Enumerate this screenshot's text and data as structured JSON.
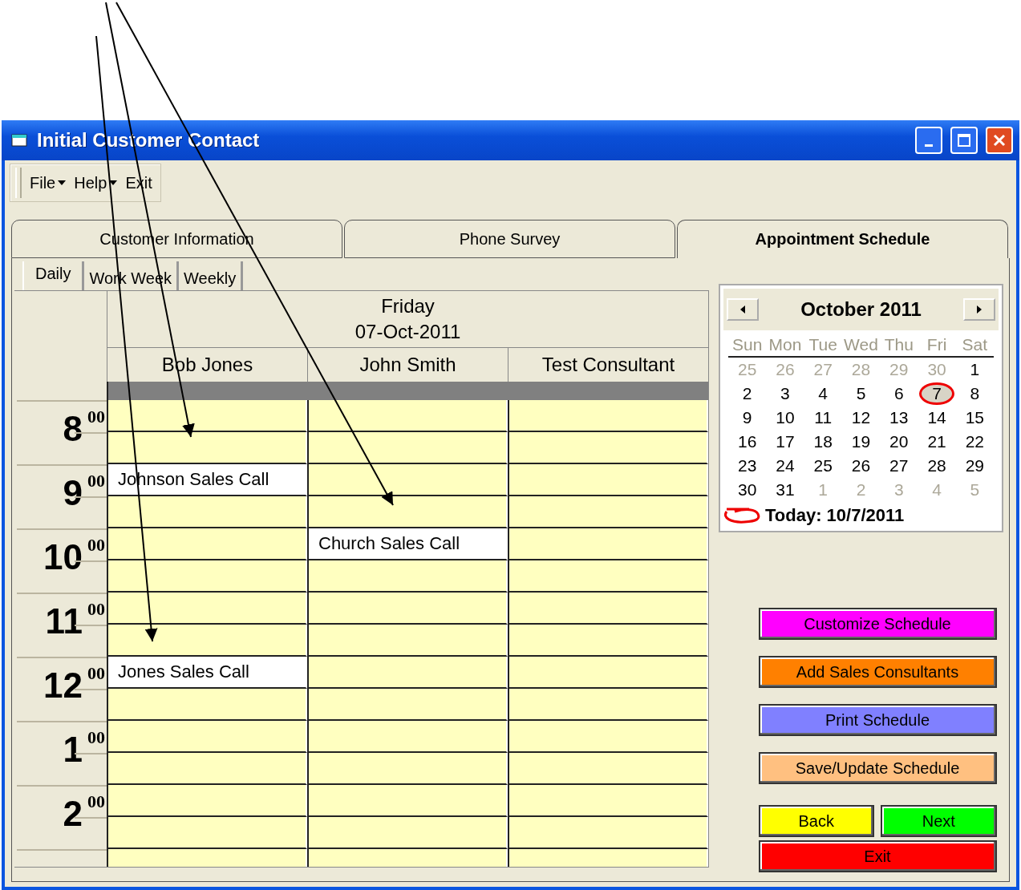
{
  "window": {
    "title": "Initial Customer Contact"
  },
  "menu": [
    {
      "label": "File",
      "has_menu": true
    },
    {
      "label": "Help",
      "has_menu": true
    },
    {
      "label": "Exit",
      "has_menu": false
    }
  ],
  "tabs": [
    {
      "label": "Customer Information",
      "selected": false
    },
    {
      "label": "Phone Survey",
      "selected": false
    },
    {
      "label": "Appointment Schedule",
      "selected": true
    }
  ],
  "view_tabs": [
    {
      "label": "Daily",
      "selected": true
    },
    {
      "label": "Work Week",
      "selected": false
    },
    {
      "label": "Weekly",
      "selected": false
    }
  ],
  "schedule": {
    "day": "Friday",
    "date": "07-Oct-2011",
    "consultants": [
      "Bob Jones",
      "John Smith",
      "Test Consultant"
    ],
    "hours": [
      {
        "hour": "8",
        "minutes": "00",
        "slots": [
          {
            "cells": [
              {
                "kind": "empty"
              },
              {
                "kind": "empty"
              },
              {
                "kind": "empty"
              }
            ]
          },
          {
            "cells": [
              {
                "kind": "empty"
              },
              {
                "kind": "empty"
              },
              {
                "kind": "empty"
              }
            ]
          }
        ]
      },
      {
        "hour": "9",
        "minutes": "00",
        "slots": [
          {
            "cells": [
              {
                "kind": "appointment",
                "text": "Johnson Sales Call"
              },
              {
                "kind": "empty"
              },
              {
                "kind": "empty"
              }
            ]
          },
          {
            "cells": [
              {
                "kind": "empty"
              },
              {
                "kind": "empty"
              },
              {
                "kind": "empty"
              }
            ]
          }
        ]
      },
      {
        "hour": "10",
        "minutes": "00",
        "slots": [
          {
            "cells": [
              {
                "kind": "empty"
              },
              {
                "kind": "appointment",
                "text": "Church Sales Call"
              },
              {
                "kind": "empty"
              }
            ]
          },
          {
            "cells": [
              {
                "kind": "empty"
              },
              {
                "kind": "empty"
              },
              {
                "kind": "empty"
              }
            ]
          }
        ]
      },
      {
        "hour": "11",
        "minutes": "00",
        "slots": [
          {
            "cells": [
              {
                "kind": "empty"
              },
              {
                "kind": "empty"
              },
              {
                "kind": "empty"
              }
            ]
          },
          {
            "cells": [
              {
                "kind": "empty"
              },
              {
                "kind": "empty"
              },
              {
                "kind": "empty"
              }
            ]
          }
        ]
      },
      {
        "hour": "12",
        "minutes": "00",
        "slots": [
          {
            "cells": [
              {
                "kind": "appointment",
                "text": "Jones Sales Call"
              },
              {
                "kind": "empty"
              },
              {
                "kind": "empty"
              }
            ]
          },
          {
            "cells": [
              {
                "kind": "empty"
              },
              {
                "kind": "empty"
              },
              {
                "kind": "empty"
              }
            ]
          }
        ]
      },
      {
        "hour": "1",
        "minutes": "00",
        "slots": [
          {
            "cells": [
              {
                "kind": "empty"
              },
              {
                "kind": "empty"
              },
              {
                "kind": "empty"
              }
            ]
          },
          {
            "cells": [
              {
                "kind": "empty"
              },
              {
                "kind": "empty"
              },
              {
                "kind": "empty"
              }
            ]
          }
        ]
      },
      {
        "hour": "2",
        "minutes": "00",
        "slots": [
          {
            "cells": [
              {
                "kind": "empty"
              },
              {
                "kind": "empty"
              },
              {
                "kind": "empty"
              }
            ]
          },
          {
            "cells": [
              {
                "kind": "empty"
              },
              {
                "kind": "empty"
              },
              {
                "kind": "empty"
              }
            ]
          }
        ]
      }
    ]
  },
  "calendar": {
    "month": "October 2011",
    "weekdays": [
      "Sun",
      "Mon",
      "Tue",
      "Wed",
      "Thu",
      "Fri",
      "Sat"
    ],
    "weeks": [
      [
        {
          "label": "25",
          "muted": true,
          "selected": false
        },
        {
          "label": "26",
          "muted": true,
          "selected": false
        },
        {
          "label": "27",
          "muted": true,
          "selected": false
        },
        {
          "label": "28",
          "muted": true,
          "selected": false
        },
        {
          "label": "29",
          "muted": true,
          "selected": false
        },
        {
          "label": "30",
          "muted": true,
          "selected": false
        },
        {
          "label": "1",
          "muted": false,
          "selected": false
        }
      ],
      [
        {
          "label": "2",
          "muted": false,
          "selected": false
        },
        {
          "label": "3",
          "muted": false,
          "selected": false
        },
        {
          "label": "4",
          "muted": false,
          "selected": false
        },
        {
          "label": "5",
          "muted": false,
          "selected": false
        },
        {
          "label": "6",
          "muted": false,
          "selected": false
        },
        {
          "label": "7",
          "muted": false,
          "selected": true
        },
        {
          "label": "8",
          "muted": false,
          "selected": false
        }
      ],
      [
        {
          "label": "9",
          "muted": false,
          "selected": false
        },
        {
          "label": "10",
          "muted": false,
          "selected": false
        },
        {
          "label": "11",
          "muted": false,
          "selected": false
        },
        {
          "label": "12",
          "muted": false,
          "selected": false
        },
        {
          "label": "13",
          "muted": false,
          "selected": false
        },
        {
          "label": "14",
          "muted": false,
          "selected": false
        },
        {
          "label": "15",
          "muted": false,
          "selected": false
        }
      ],
      [
        {
          "label": "16",
          "muted": false,
          "selected": false
        },
        {
          "label": "17",
          "muted": false,
          "selected": false
        },
        {
          "label": "18",
          "muted": false,
          "selected": false
        },
        {
          "label": "19",
          "muted": false,
          "selected": false
        },
        {
          "label": "20",
          "muted": false,
          "selected": false
        },
        {
          "label": "21",
          "muted": false,
          "selected": false
        },
        {
          "label": "22",
          "muted": false,
          "selected": false
        }
      ],
      [
        {
          "label": "23",
          "muted": false,
          "selected": false
        },
        {
          "label": "24",
          "muted": false,
          "selected": false
        },
        {
          "label": "25",
          "muted": false,
          "selected": false
        },
        {
          "label": "26",
          "muted": false,
          "selected": false
        },
        {
          "label": "27",
          "muted": false,
          "selected": false
        },
        {
          "label": "28",
          "muted": false,
          "selected": false
        },
        {
          "label": "29",
          "muted": false,
          "selected": false
        }
      ],
      [
        {
          "label": "30",
          "muted": false,
          "selected": false
        },
        {
          "label": "31",
          "muted": false,
          "selected": false
        },
        {
          "label": "1",
          "muted": true,
          "selected": false
        },
        {
          "label": "2",
          "muted": true,
          "selected": false
        },
        {
          "label": "3",
          "muted": true,
          "selected": false
        },
        {
          "label": "4",
          "muted": true,
          "selected": false
        },
        {
          "label": "5",
          "muted": true,
          "selected": false
        }
      ]
    ],
    "today": "Today: 10/7/2011"
  },
  "actions": [
    {
      "label": "Customize Schedule",
      "color": "#ff00ff"
    },
    {
      "label": "Add Sales Consultants",
      "color": "#ff8000"
    },
    {
      "label": "Print Schedule",
      "color": "#8080ff"
    },
    {
      "label": "Save/Update Schedule",
      "color": "#ffc080"
    }
  ],
  "nav_buttons": [
    {
      "label": "Back",
      "color": "#ffff00"
    },
    {
      "label": "Next",
      "color": "#00ff00"
    }
  ],
  "exit_button": {
    "label": "Exit",
    "color": "#ff0000"
  }
}
